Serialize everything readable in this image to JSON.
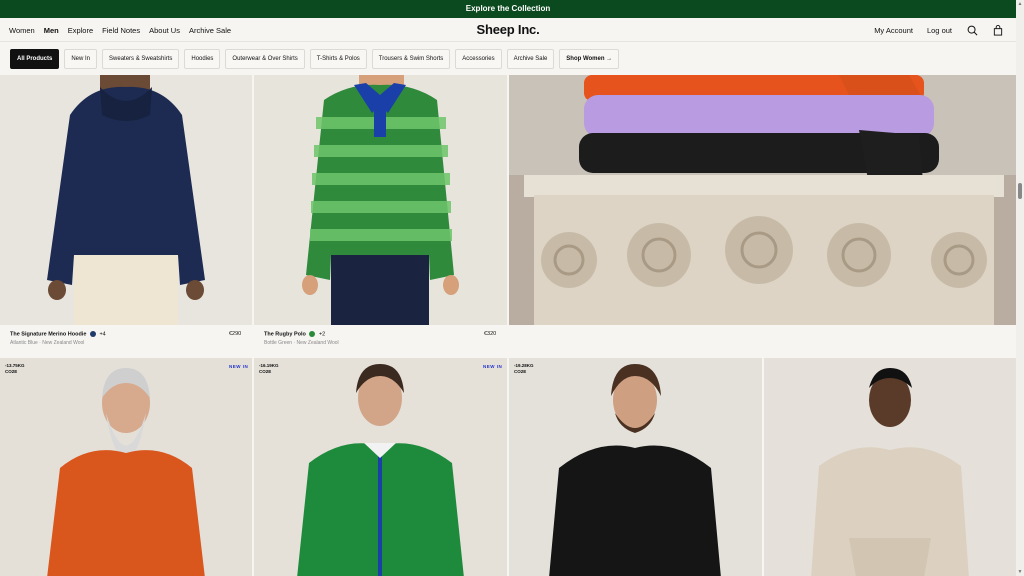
{
  "banner": {
    "text": "Explore the Collection"
  },
  "nav": {
    "left": [
      {
        "label": "Women",
        "active": false
      },
      {
        "label": "Men",
        "active": true
      },
      {
        "label": "Explore",
        "active": false
      },
      {
        "label": "Field Notes",
        "active": false
      },
      {
        "label": "About Us",
        "active": false
      },
      {
        "label": "Archive Sale",
        "active": false
      }
    ],
    "logo": "Sheep Inc.",
    "account": "My Account",
    "logout": "Log out",
    "search_icon": "search-icon",
    "bag_icon": "bag-icon"
  },
  "filters": [
    {
      "label": "All Products",
      "active": true
    },
    {
      "label": "New In"
    },
    {
      "label": "Sweaters & Sweatshirts"
    },
    {
      "label": "Hoodies"
    },
    {
      "label": "Outerwear & Over Shirts"
    },
    {
      "label": "T-Shirts & Polos"
    },
    {
      "label": "Trousers & Swim Shorts"
    },
    {
      "label": "Accessories"
    },
    {
      "label": "Archive Sale"
    },
    {
      "label": "Shop Women →",
      "bold": true
    }
  ],
  "products_row1": [
    {
      "name": "The Signature Merino Hoodie",
      "colors_more": "+4",
      "variant": "Atlantic Blue · New Zealand Wool",
      "price": "€290",
      "swatch": "#1f3a6b"
    },
    {
      "name": "The Rugby Polo",
      "colors_more": "+2",
      "variant": "Bottle Green · New Zealand Wool",
      "price": "€320",
      "swatch": "#2a8a3a"
    }
  ],
  "products_row2": [
    {
      "co2": "-13.75KG",
      "co2_unit": "CO2E",
      "new_in": "NEW IN"
    },
    {
      "co2": "-16.19KG",
      "co2_unit": "CO2E",
      "new_in": "NEW IN"
    },
    {
      "co2": "-19.28KG",
      "co2_unit": "CO2E",
      "new_in": ""
    },
    {
      "co2": "",
      "co2_unit": "",
      "new_in": ""
    }
  ]
}
